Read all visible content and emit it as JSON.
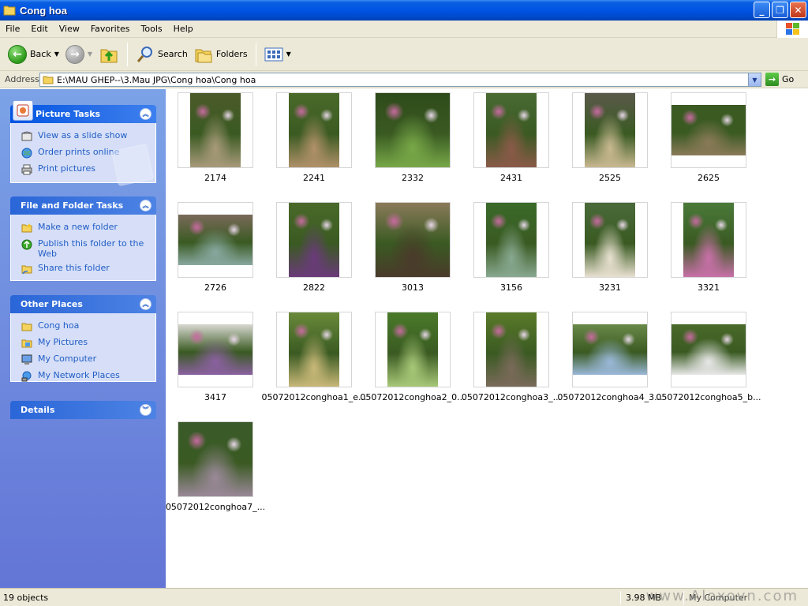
{
  "window": {
    "title": "Cong hoa"
  },
  "menu": [
    "File",
    "Edit",
    "View",
    "Favorites",
    "Tools",
    "Help"
  ],
  "toolbar": {
    "back": "Back",
    "search": "Search",
    "folders": "Folders"
  },
  "address": {
    "label": "Address",
    "path": "E:\\MAU GHEP--\\3.Mau JPG\\Cong hoa\\Cong hoa",
    "go": "Go"
  },
  "panels": {
    "picture_tasks": {
      "title": "Picture Tasks",
      "items": [
        "View as a slide show",
        "Order prints online",
        "Print pictures"
      ]
    },
    "file_tasks": {
      "title": "File and Folder Tasks",
      "items": [
        "Make a new folder",
        "Publish this folder to the Web",
        "Share this folder"
      ]
    },
    "other_places": {
      "title": "Other Places",
      "items": [
        "Cong hoa",
        "My Pictures",
        "My Computer",
        "My Network Places"
      ]
    },
    "details": {
      "title": "Details"
    }
  },
  "files": [
    {
      "name": "2174",
      "shape": "p",
      "c1": "#4c5a2a",
      "c2": "#a89a7a"
    },
    {
      "name": "2241",
      "shape": "p",
      "c1": "#4a6a2a",
      "c2": "#b09068"
    },
    {
      "name": "2332",
      "shape": "s",
      "c1": "#2e4a1a",
      "c2": "#78a848"
    },
    {
      "name": "2431",
      "shape": "p",
      "c1": "#4a6a34",
      "c2": "#8a5a48"
    },
    {
      "name": "2525",
      "shape": "p",
      "c1": "#5a5a4a",
      "c2": "#c8b890"
    },
    {
      "name": "2625",
      "shape": "l",
      "c1": "#3a5a22",
      "c2": "#8a7a58"
    },
    {
      "name": "2726",
      "shape": "l",
      "c1": "#7a6a5a",
      "c2": "#88a8a0"
    },
    {
      "name": "2822",
      "shape": "p",
      "c1": "#4a6a2a",
      "c2": "#6a3a7a"
    },
    {
      "name": "3013",
      "shape": "s",
      "c1": "#8a7a5a",
      "c2": "#4a3a2a"
    },
    {
      "name": "3156",
      "shape": "p",
      "c1": "#3a6a2a",
      "c2": "#88a890"
    },
    {
      "name": "3231",
      "shape": "p",
      "c1": "#4a6a3a",
      "c2": "#e8e0d0"
    },
    {
      "name": "3321",
      "shape": "p",
      "c1": "#4a7a3a",
      "c2": "#c870a8"
    },
    {
      "name": "3417",
      "shape": "l",
      "c1": "#d8d8d0",
      "c2": "#8a60a0"
    },
    {
      "name": "05072012conghoa1_e...",
      "shape": "p",
      "c1": "#6a8a3a",
      "c2": "#c8b878"
    },
    {
      "name": "05072012conghoa2_0...",
      "shape": "p",
      "c1": "#4a7a2a",
      "c2": "#a8c878"
    },
    {
      "name": "05072012conghoa3_...",
      "shape": "p",
      "c1": "#5a7a2a",
      "c2": "#7a6a5a"
    },
    {
      "name": "05072012conghoa4_3...",
      "shape": "l",
      "c1": "#6a8a4a",
      "c2": "#9ab8d8"
    },
    {
      "name": "05072012conghoa5_b...",
      "shape": "l",
      "c1": "#4a6a2a",
      "c2": "#e8e8e8"
    },
    {
      "name": "05072012conghoa7_...",
      "shape": "s",
      "c1": "#3a5a2a",
      "c2": "#9a8898"
    }
  ],
  "status": {
    "objects": "19 objects",
    "size": "3.98 MB",
    "location": "My Computer",
    "watermark": "www.Aloxovn.com"
  }
}
